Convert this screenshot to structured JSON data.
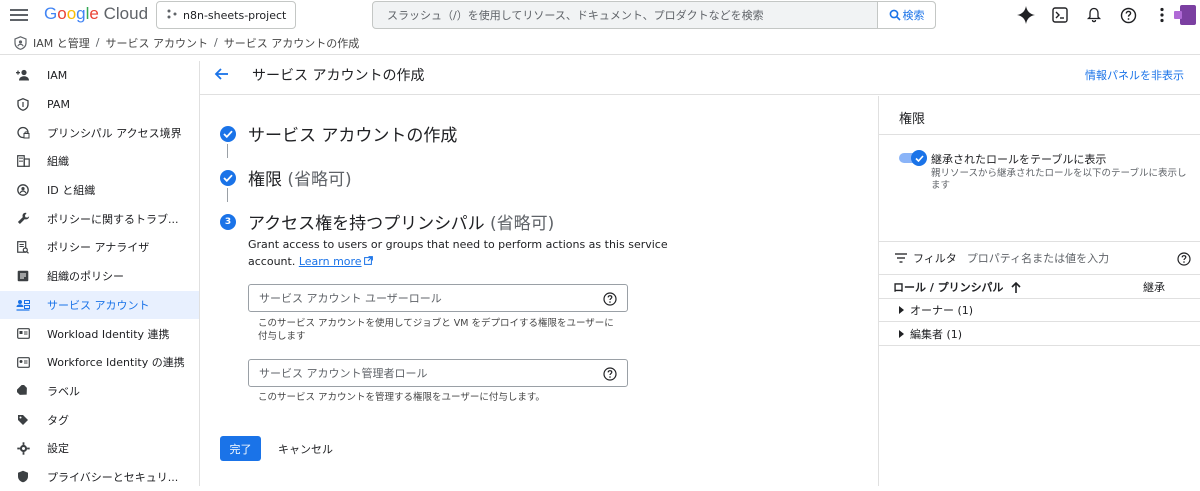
{
  "header": {
    "logo_google": "Google",
    "logo_cloud": "Cloud",
    "project": "n8n-sheets-project",
    "search_placeholder": "スラッシュ（/）を使用してリソース、ドキュメント、プロダクトなどを検索",
    "search_button": "検索"
  },
  "breadcrumb": [
    "IAM と管理",
    "サービス アカウント",
    "サービス アカウントの作成"
  ],
  "sidebar": {
    "items": [
      {
        "label": "IAM",
        "icon": "person-add-icon"
      },
      {
        "label": "PAM",
        "icon": "shield-icon"
      },
      {
        "label": "プリンシパル アクセス境界",
        "icon": "shield-lock-icon"
      },
      {
        "label": "組織",
        "icon": "building-icon"
      },
      {
        "label": "ID と組織",
        "icon": "id-icon"
      },
      {
        "label": "ポリシーに関するトラブ...",
        "icon": "wrench-icon"
      },
      {
        "label": "ポリシー アナライザ",
        "icon": "doc-search-icon"
      },
      {
        "label": "組織のポリシー",
        "icon": "list-doc-icon"
      },
      {
        "label": "サービス アカウント",
        "icon": "service-account-icon",
        "active": true
      },
      {
        "label": "Workload Identity 連携",
        "icon": "id-card-icon"
      },
      {
        "label": "Workforce Identity の連携",
        "icon": "id-card-icon"
      },
      {
        "label": "ラベル",
        "icon": "label-icon"
      },
      {
        "label": "タグ",
        "icon": "tag-icon"
      },
      {
        "label": "設定",
        "icon": "gear-icon"
      },
      {
        "label": "プライバシーとセキュリ...",
        "icon": "shield-icon"
      }
    ]
  },
  "page": {
    "title": "サービス アカウントの作成",
    "hide_panel": "情報パネルを非表示"
  },
  "steps": {
    "step1": "サービス アカウントの作成",
    "step2": "権限",
    "step2_opt": "(省略可)",
    "step3_num": "3",
    "step3": "アクセス権を持つプリンシパル",
    "step3_opt": "(省略可)",
    "desc": "Grant access to users or groups that need to perform actions as this service account.",
    "learn_more": "Learn more"
  },
  "fields": {
    "user_role_placeholder": "サービス アカウント ユーザーロール",
    "user_role_hint": "このサービス アカウントを使用してジョブと VM をデプロイする権限をユーザーに付与します",
    "admin_role_placeholder": "サービス アカウント管理者ロール",
    "admin_role_hint": "このサービス アカウントを管理する権限をユーザーに付与します。"
  },
  "buttons": {
    "done": "完了",
    "cancel": "キャンセル"
  },
  "panel": {
    "title": "権限",
    "toggle_label": "継承されたロールをテーブルに表示",
    "toggle_sub": "親リソースから継承されたロールを以下のテーブルに表示します",
    "filter_label": "フィルタ",
    "filter_placeholder": "プロパティ名または値を入力",
    "col_role": "ロール / プリンシパル",
    "col_inherit": "継承",
    "rows": [
      "オーナー (1)",
      "編集者 (1)"
    ]
  },
  "colors": {
    "accent": "#1a73e8",
    "active_bg": "#e8f0fe"
  }
}
